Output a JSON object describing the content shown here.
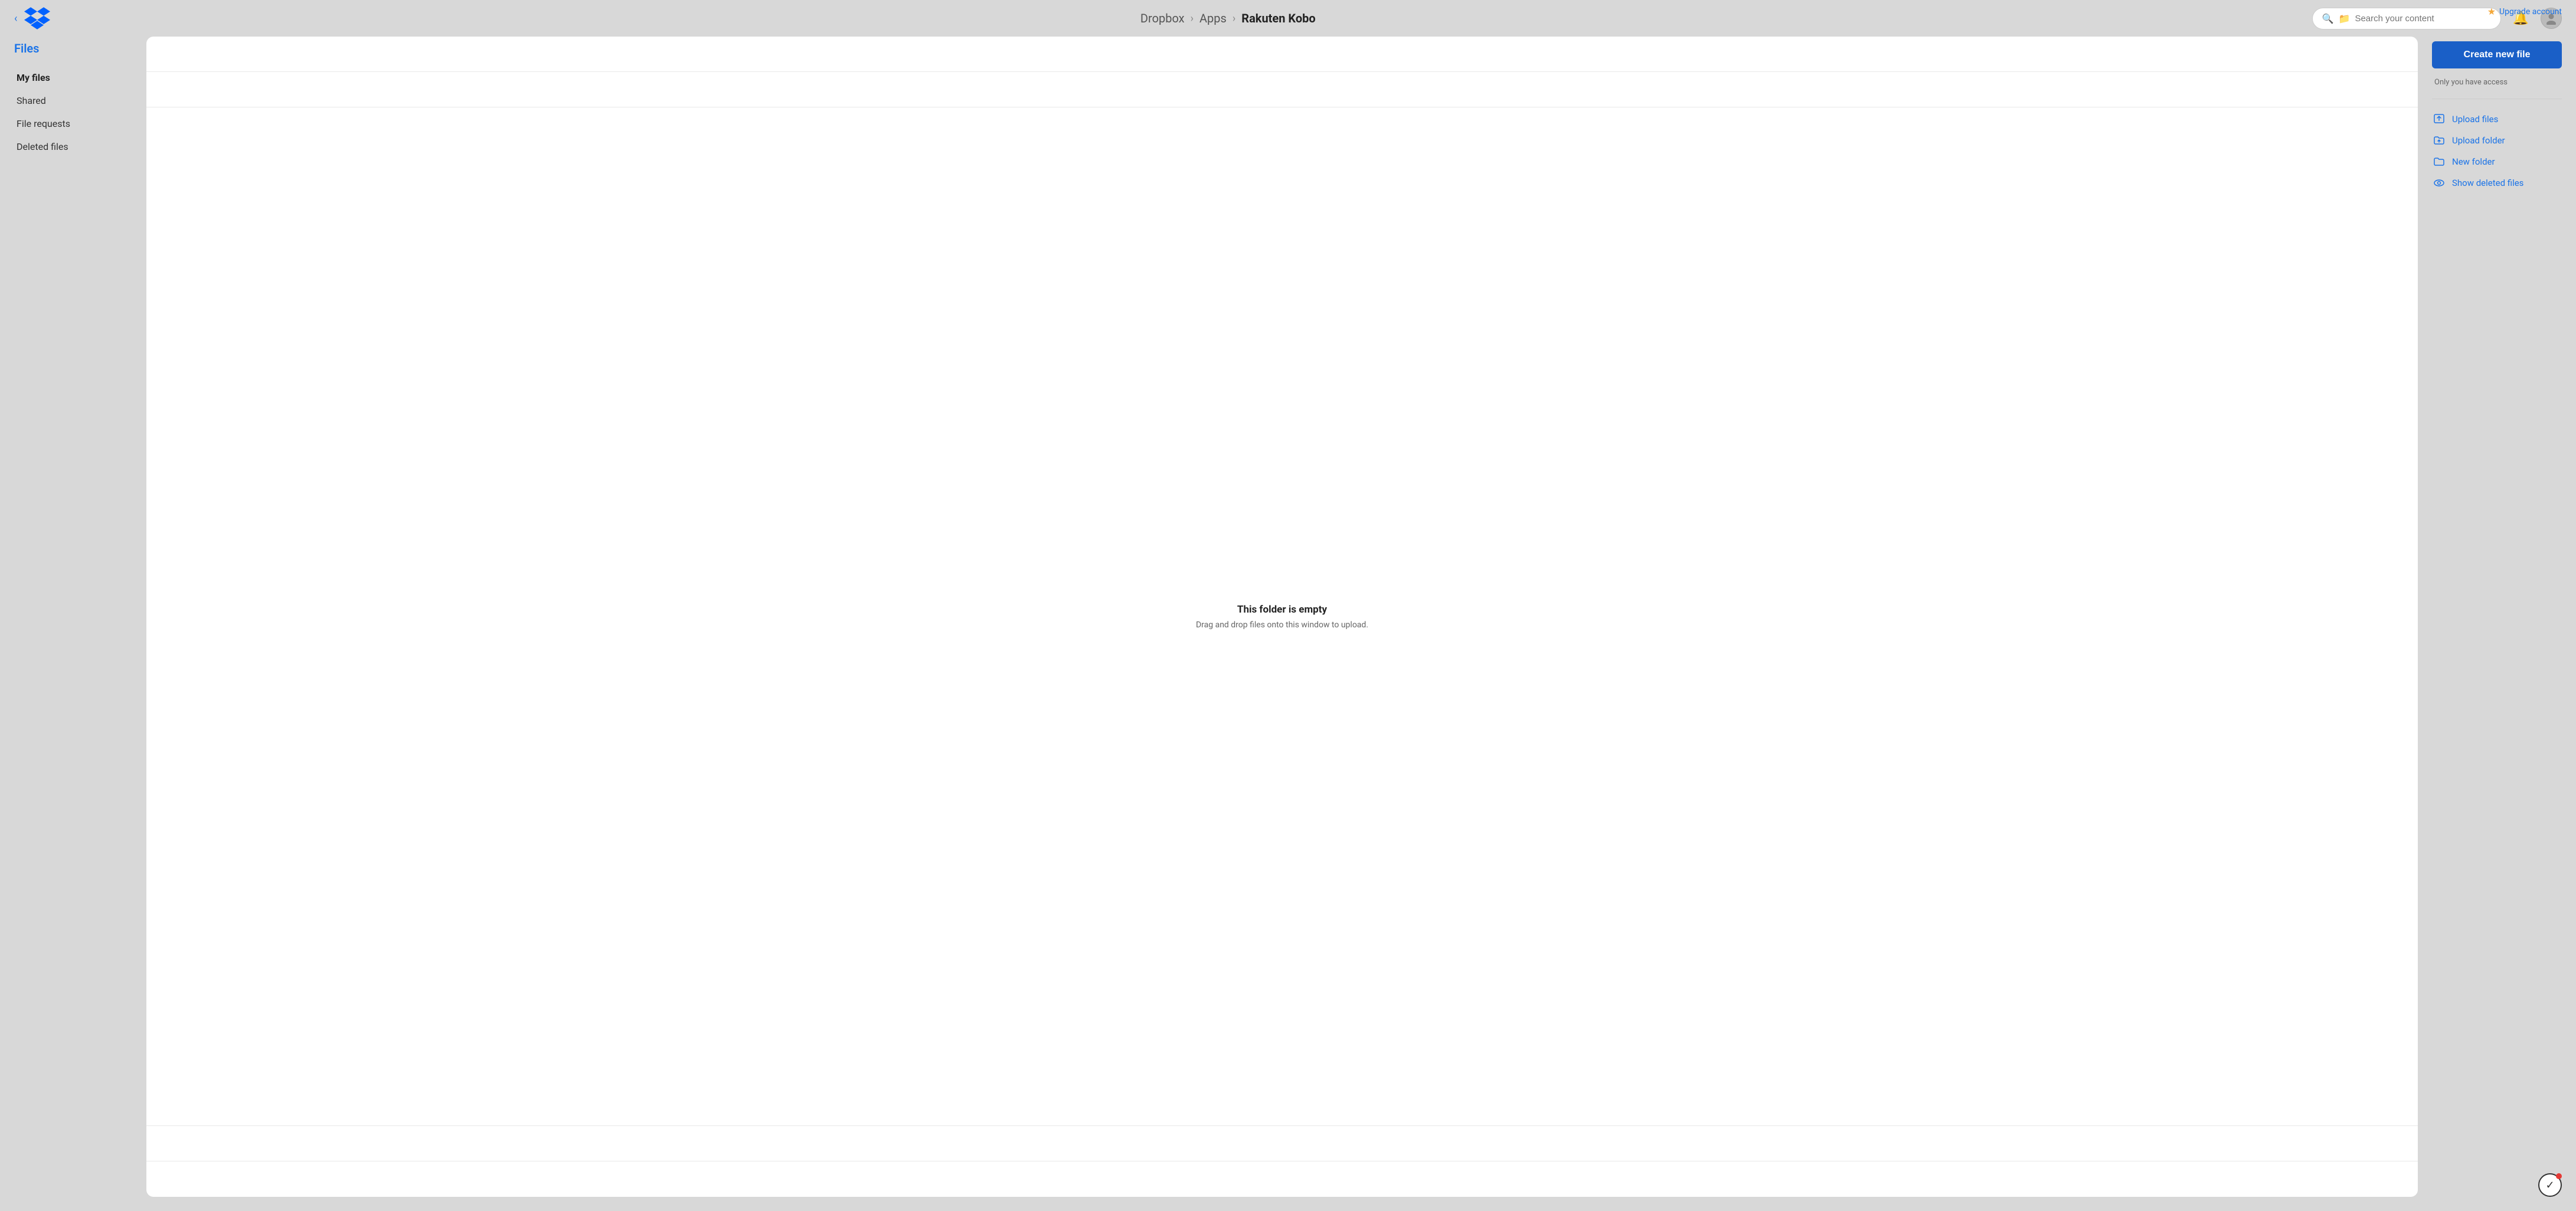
{
  "topbar": {
    "upgrade_label": "Upgrade account",
    "breadcrumb": {
      "root": "Dropbox",
      "sep1": "›",
      "middle": "Apps",
      "sep2": "›",
      "current": "Rakuten Kobo"
    },
    "search": {
      "placeholder": "Search your content"
    }
  },
  "sidebar": {
    "section_title": "Files",
    "items": [
      {
        "label": "My files",
        "active": true
      },
      {
        "label": "Shared",
        "active": false
      },
      {
        "label": "File requests",
        "active": false
      },
      {
        "label": "Deleted files",
        "active": false
      }
    ]
  },
  "file_area": {
    "empty_title": "This folder is empty",
    "empty_subtitle": "Drag and drop files onto this window to upload."
  },
  "right_panel": {
    "create_btn": "Create new file",
    "access_text": "Only you have access",
    "actions": [
      {
        "label": "Upload files",
        "icon": "upload-files-icon"
      },
      {
        "label": "Upload folder",
        "icon": "upload-folder-icon"
      },
      {
        "label": "New folder",
        "icon": "new-folder-icon"
      },
      {
        "label": "Show deleted files",
        "icon": "show-deleted-icon"
      }
    ]
  }
}
